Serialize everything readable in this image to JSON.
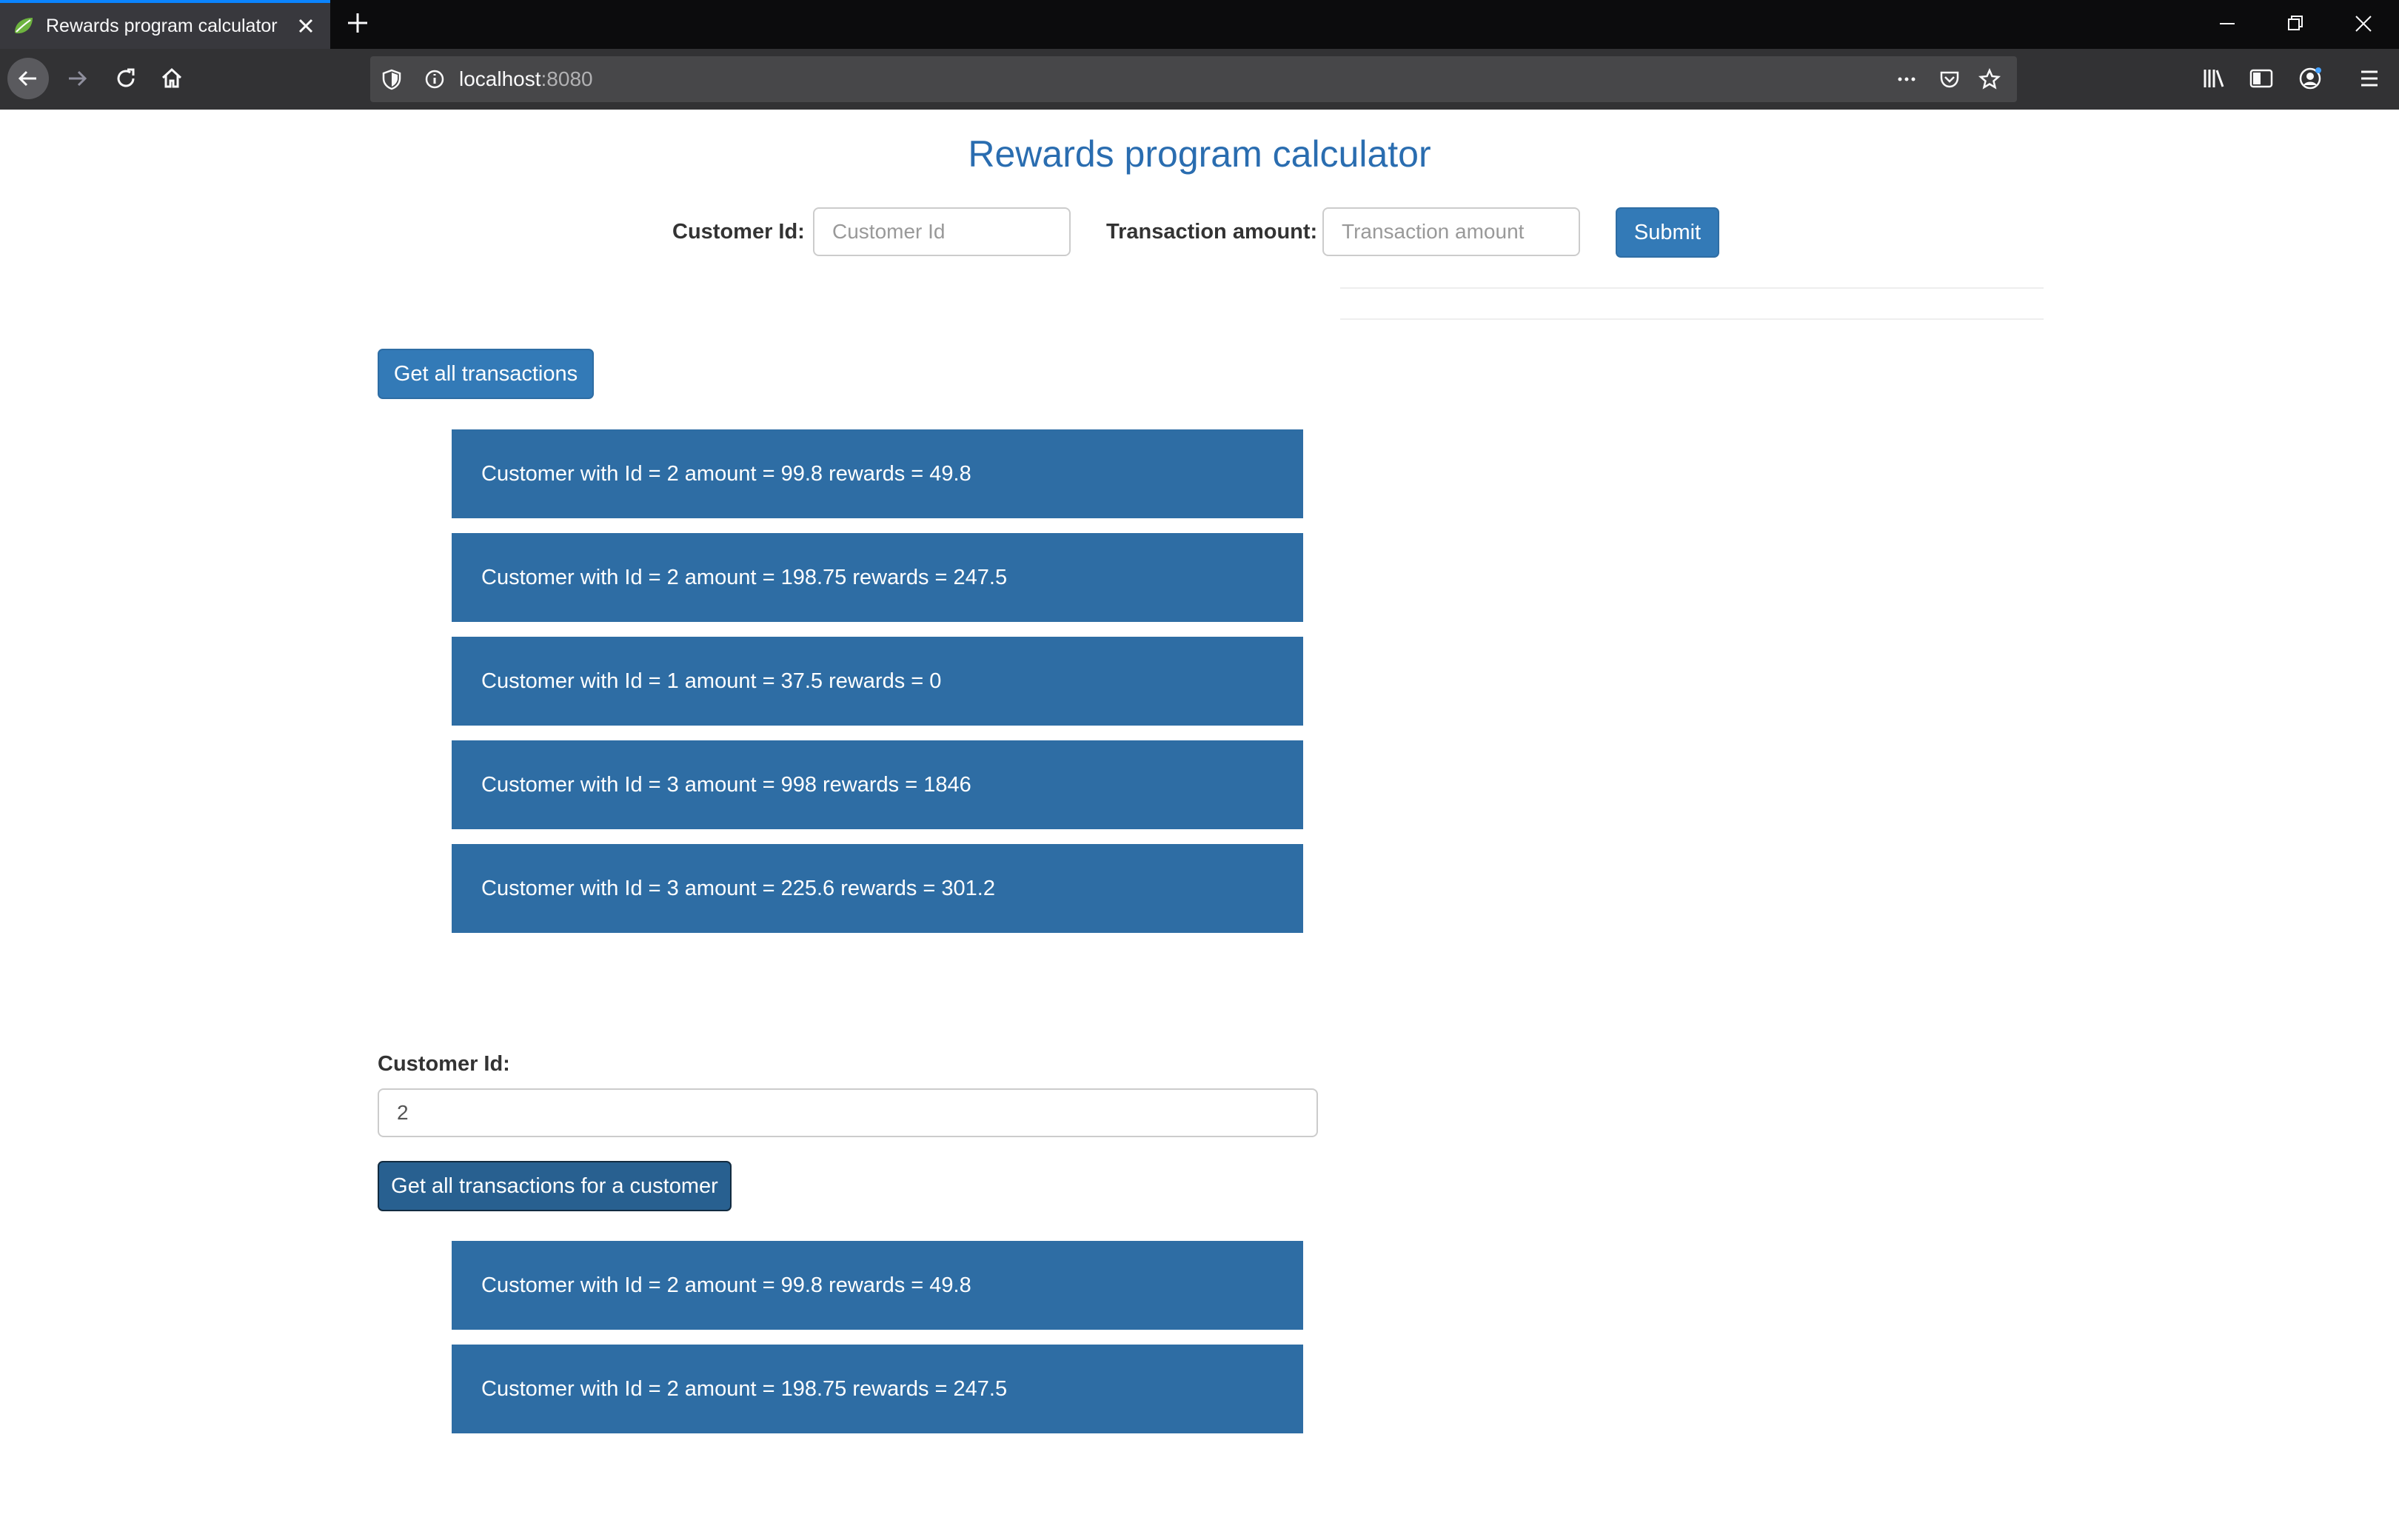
{
  "browser": {
    "tab_title": "Rewards program calculator",
    "url_host": "localhost",
    "url_port": ":8080"
  },
  "page": {
    "title": "Rewards program calculator",
    "form": {
      "customer_id_label": "Customer Id:",
      "customer_id_placeholder": "Customer Id",
      "customer_id_value": "",
      "amount_label": "Transaction amount:",
      "amount_placeholder": "Transaction amount",
      "amount_value": "",
      "submit_label": "Submit"
    },
    "all_transactions": {
      "button_label": "Get all transactions",
      "items": [
        "Customer with Id = 2 amount = 99.8 rewards = 49.8",
        "Customer with Id = 2 amount = 198.75 rewards = 247.5",
        "Customer with Id = 1 amount = 37.5 rewards = 0",
        "Customer with Id = 3 amount = 998 rewards = 1846",
        "Customer with Id = 3 amount = 225.6 rewards = 301.2"
      ]
    },
    "customer_transactions": {
      "label": "Customer Id:",
      "input_value": "2",
      "button_label": "Get all transactions for a customer",
      "items": [
        "Customer with Id = 2 amount = 99.8 rewards = 49.8",
        "Customer with Id = 2 amount = 198.75 rewards = 247.5"
      ]
    }
  },
  "colors": {
    "accent": "#337ab7",
    "title": "#2a6db0",
    "list_item_bg": "#2e6da4"
  },
  "icons": [
    "spring-leaf-icon",
    "close-icon",
    "plus-icon",
    "minimize-icon",
    "restore-icon",
    "window-close-icon",
    "back-arrow-icon",
    "forward-arrow-icon",
    "reload-icon",
    "home-icon",
    "tracking-shield-icon",
    "info-icon",
    "more-icon",
    "pocket-icon",
    "bookmark-star-icon",
    "library-icon",
    "sidebar-icon",
    "account-icon",
    "menu-icon"
  ]
}
